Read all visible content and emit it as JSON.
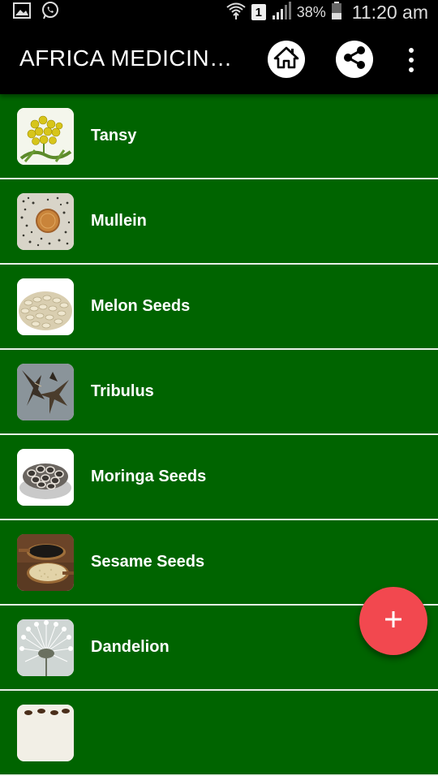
{
  "status_bar": {
    "sim_label": "1",
    "battery_percent": "38%",
    "time": "11:20 am"
  },
  "app_bar": {
    "title": "AFRICA MEDICINA…"
  },
  "items": [
    {
      "label": "Tansy"
    },
    {
      "label": "Mullein"
    },
    {
      "label": "Melon Seeds"
    },
    {
      "label": "Tribulus"
    },
    {
      "label": "Moringa Seeds"
    },
    {
      "label": "Sesame Seeds"
    },
    {
      "label": "Dandelion"
    },
    {
      "label": ""
    }
  ],
  "colors": {
    "list_background": "#006400",
    "app_bar": "#000000",
    "fab": "#f2484f"
  },
  "icons": [
    "image-icon",
    "whatsapp-icon",
    "wifi-icon",
    "signal-icon",
    "battery-icon",
    "home-icon",
    "share-icon",
    "more-vert-icon",
    "plus-icon"
  ]
}
